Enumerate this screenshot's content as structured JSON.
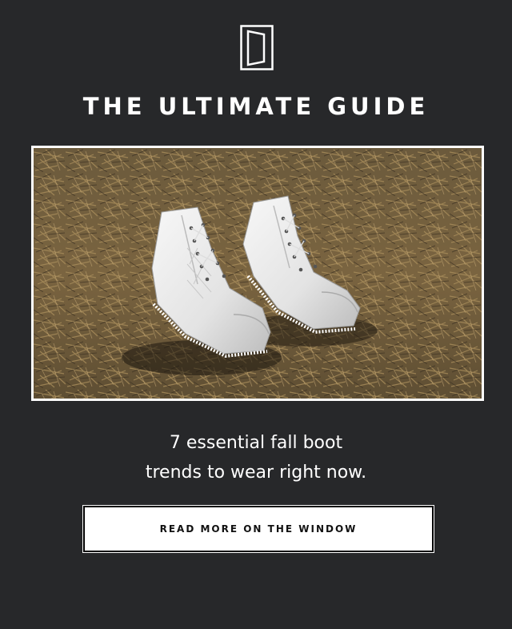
{
  "header": {
    "logo_icon": "door-icon",
    "title": "THE ULTIMATE GUIDE"
  },
  "hero": {
    "image_subject": "white-ankle-boots-on-dry-grass"
  },
  "caption": {
    "line1": "7 essential fall boot",
    "line2": "trends to wear right now."
  },
  "cta": {
    "label": "READ MORE ON THE WINDOW"
  },
  "colors": {
    "background": "#27282a",
    "text": "#ffffff",
    "button_bg": "#ffffff",
    "button_text": "#111111"
  }
}
